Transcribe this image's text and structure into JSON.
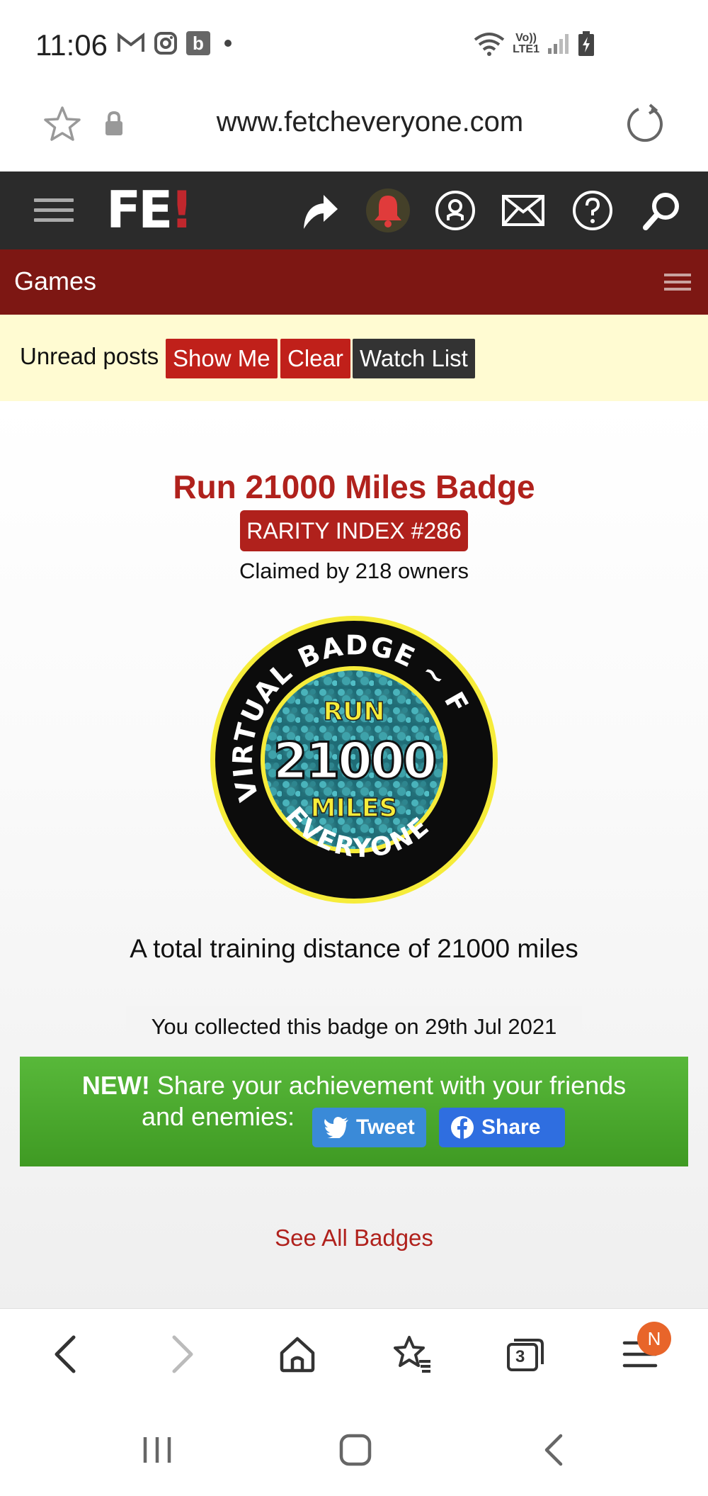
{
  "status_bar": {
    "time": "11:06",
    "left_icons": [
      "gmail-icon",
      "instagram-icon",
      "b-app-icon",
      "dot-icon"
    ],
    "b_letter": "b",
    "network_label_top": "Vo))",
    "network_label_bottom": "LTE1"
  },
  "url_bar": {
    "url": "www.fetcheveryone.com"
  },
  "site_nav": {
    "logo_main": "FE",
    "logo_bang": "!",
    "icons": [
      "share-arrow-icon",
      "bell-icon",
      "account-icon",
      "mail-icon",
      "help-icon",
      "search-icon"
    ]
  },
  "section": {
    "title": "Games"
  },
  "unread": {
    "label": "Unread posts",
    "show_me": "Show Me",
    "clear": "Clear",
    "watch_list": "Watch List"
  },
  "badge": {
    "title": "Run 21000 Miles Badge",
    "rarity": "RARITY INDEX #286",
    "claimed": "Claimed by 218 owners",
    "ring_text_top": "VIRTUAL BADGE ~ FETCH",
    "ring_text_bottom": "EVERYONE",
    "center_run": "RUN",
    "center_number": "21000",
    "center_miles": "MILES",
    "description": "A total training distance of 21000 miles",
    "collected": "You collected this badge on 29th Jul 2021"
  },
  "share": {
    "new_label": "NEW!",
    "text_line1": "Share your achievement with your friends",
    "text_line2": "and enemies:",
    "tweet_label": "Tweet",
    "share_label": "Share"
  },
  "see_all": "See All Badges",
  "browser_bottom": {
    "tabs_count": "3",
    "notif_letter": "N"
  },
  "colors": {
    "brand_red": "#b0211c",
    "nav_dark": "#2b2b2b",
    "games_bar": "#7d1713",
    "unread_bg": "#fffbd2",
    "share_green": "#4caf30",
    "twitter_blue": "#3a8ad8",
    "facebook_blue": "#2f6ee0"
  }
}
